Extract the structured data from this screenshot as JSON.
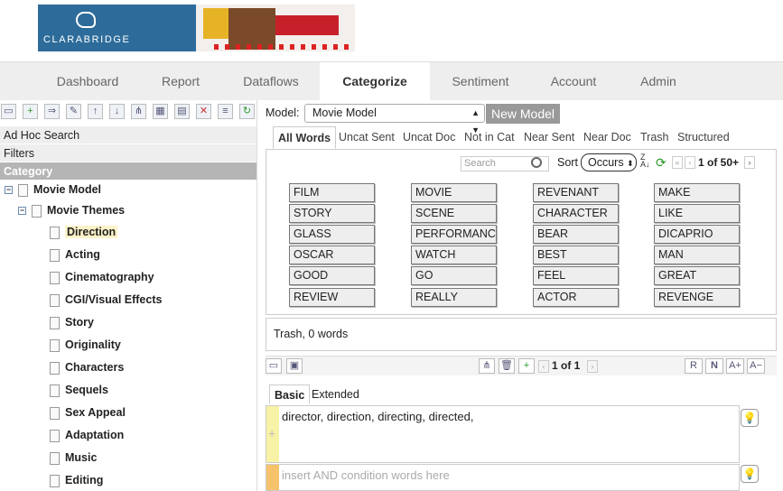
{
  "brand": {
    "logo_text": "CLARABRIDGE"
  },
  "nav": {
    "tabs": [
      {
        "label": "Dashboard"
      },
      {
        "label": "Report"
      },
      {
        "label": "Dataflows"
      },
      {
        "label": "Categorize",
        "active": true
      },
      {
        "label": "Sentiment"
      },
      {
        "label": "Account"
      },
      {
        "label": "Admin"
      }
    ]
  },
  "sidebar": {
    "sections": [
      "Ad Hoc Search",
      "Filters",
      "Category"
    ],
    "tree": {
      "root": "Movie Model",
      "child": "Movie Themes",
      "items": [
        "Direction",
        "Acting",
        "Cinematography",
        "CGI/Visual Effects",
        "Story",
        "Originality",
        "Characters",
        "Sequels",
        "Sex Appeal",
        "Adaptation",
        "Music",
        "Editing"
      ],
      "selected": "Direction"
    }
  },
  "model": {
    "label": "Model:",
    "selected": "Movie Model",
    "new_button": "New Model"
  },
  "word_tabs": [
    "All Words",
    "Uncat Sent",
    "Uncat Doc",
    "Not in Cat",
    "Near Sent",
    "Near Doc",
    "Trash",
    "Structured"
  ],
  "word_panel": {
    "search_placeholder": "Search",
    "sort_label": "Sort",
    "sort_value": "Occurs",
    "page_info": "1 of 50+",
    "words": [
      [
        "FILM",
        "MOVIE",
        "REVENANT",
        "MAKE"
      ],
      [
        "STORY",
        "SCENE",
        "CHARACTER",
        "LIKE"
      ],
      [
        "GLASS",
        "PERFORMANCE",
        "BEAR",
        "DICAPRIO"
      ],
      [
        "OSCAR",
        "WATCH",
        "BEST",
        "MAN"
      ],
      [
        "GOOD",
        "GO",
        "FEEL",
        "GREAT"
      ],
      [
        "REVIEW",
        "REALLY",
        "ACTOR",
        "REVENGE"
      ]
    ]
  },
  "trash": {
    "text": "Trash, 0 words"
  },
  "rule_pager": {
    "page_info": "1 of 1"
  },
  "rule_tabs": [
    "Basic",
    "Extended"
  ],
  "rules": {
    "or_words": "director, direction, directing, directed,",
    "and_placeholder": "insert AND condition words here"
  },
  "colors": {
    "accent": "#2d6c9a",
    "selected_bg": "#fdf3c8",
    "category_header": "#b5b5b5"
  }
}
